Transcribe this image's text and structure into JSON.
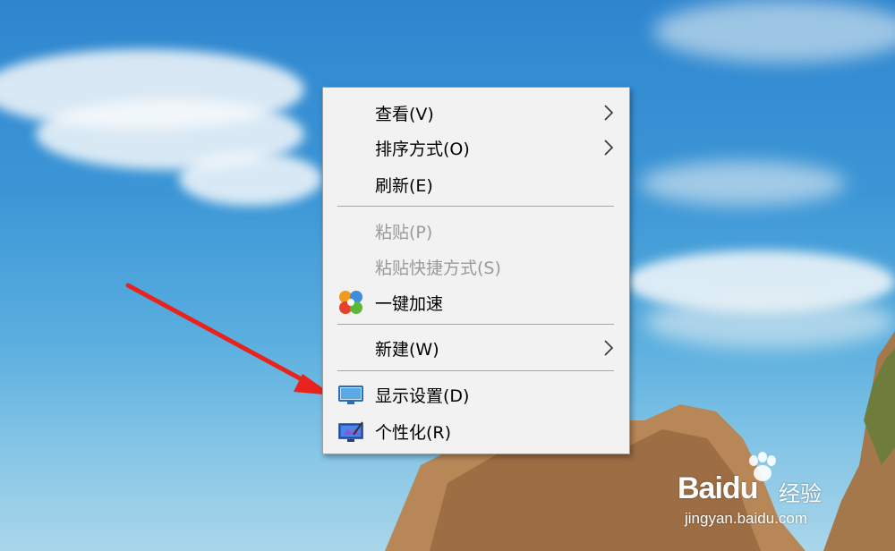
{
  "context_menu": {
    "items": [
      {
        "label": "查看(V)",
        "submenu": true,
        "enabled": true
      },
      {
        "label": "排序方式(O)",
        "submenu": true,
        "enabled": true
      },
      {
        "label": "刷新(E)",
        "submenu": false,
        "enabled": true
      },
      {
        "label": "粘贴(P)",
        "submenu": false,
        "enabled": false
      },
      {
        "label": "粘贴快捷方式(S)",
        "submenu": false,
        "enabled": false
      },
      {
        "label": "一键加速",
        "submenu": false,
        "enabled": true,
        "icon": "speedup-icon"
      },
      {
        "label": "新建(W)",
        "submenu": true,
        "enabled": true
      },
      {
        "label": "显示设置(D)",
        "submenu": false,
        "enabled": true,
        "icon": "display-icon"
      },
      {
        "label": "个性化(R)",
        "submenu": false,
        "enabled": true,
        "icon": "personalize-icon"
      }
    ]
  },
  "watermark": {
    "logo_bai": "Bai",
    "logo_du": "du",
    "logo_jingyan": "经验",
    "url": "jingyan.baidu.com"
  },
  "colors": {
    "menu_bg": "#f2f2f2",
    "arrow": "#e8231e"
  }
}
